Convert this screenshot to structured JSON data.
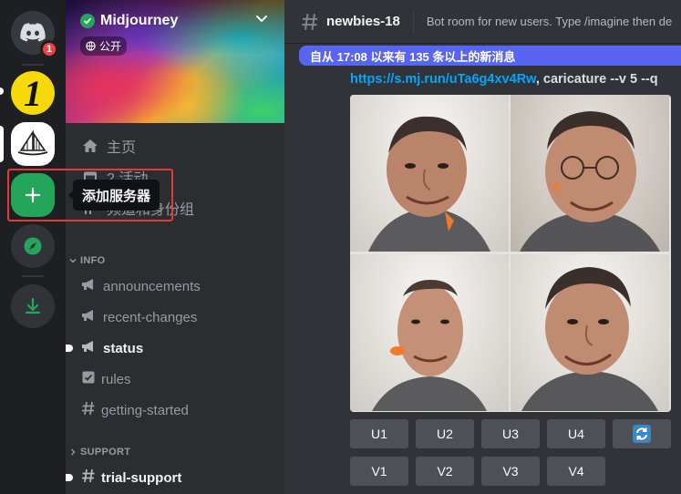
{
  "rail": {
    "badge_count": "1",
    "server_one_glyph": "1",
    "tooltip": "添加服务器"
  },
  "sidebar": {
    "guild_name": "Midjourney",
    "public_label": "公开",
    "home": "主页",
    "events": "2 活动",
    "channels_roles": "频道和身份组",
    "categories": [
      {
        "name": "INFO",
        "channels": [
          {
            "name": "announcements",
            "icon": "megaphone-icon"
          },
          {
            "name": "recent-changes",
            "icon": "megaphone-icon"
          },
          {
            "name": "status",
            "icon": "megaphone-icon"
          },
          {
            "name": "rules",
            "icon": "rules-icon"
          },
          {
            "name": "getting-started",
            "icon": "hash-icon"
          }
        ]
      },
      {
        "name": "SUPPORT",
        "channels": [
          {
            "name": "trial-support",
            "icon": "hash-icon"
          }
        ]
      }
    ]
  },
  "main": {
    "channel_name": "newbies-18",
    "topic": "Bot room for new users. Type /imagine then de",
    "new_messages_bar": "自从 17:08 以来有 135 条以上的新消息",
    "message": {
      "link": "https://s.mj.run/uTa6g4xv4Rw",
      "prompt_text": ", caricature --v 5 --q"
    },
    "buttons_upscale": [
      "U1",
      "U2",
      "U3",
      "U4"
    ],
    "buttons_variation": [
      "V1",
      "V2",
      "V3",
      "V4"
    ],
    "reroll_icon": "refresh-icon"
  },
  "colors": {
    "accent": "#5865f2",
    "link": "#00a8fc",
    "add_server": "#23a55a",
    "highlight_box": "#e53935"
  }
}
